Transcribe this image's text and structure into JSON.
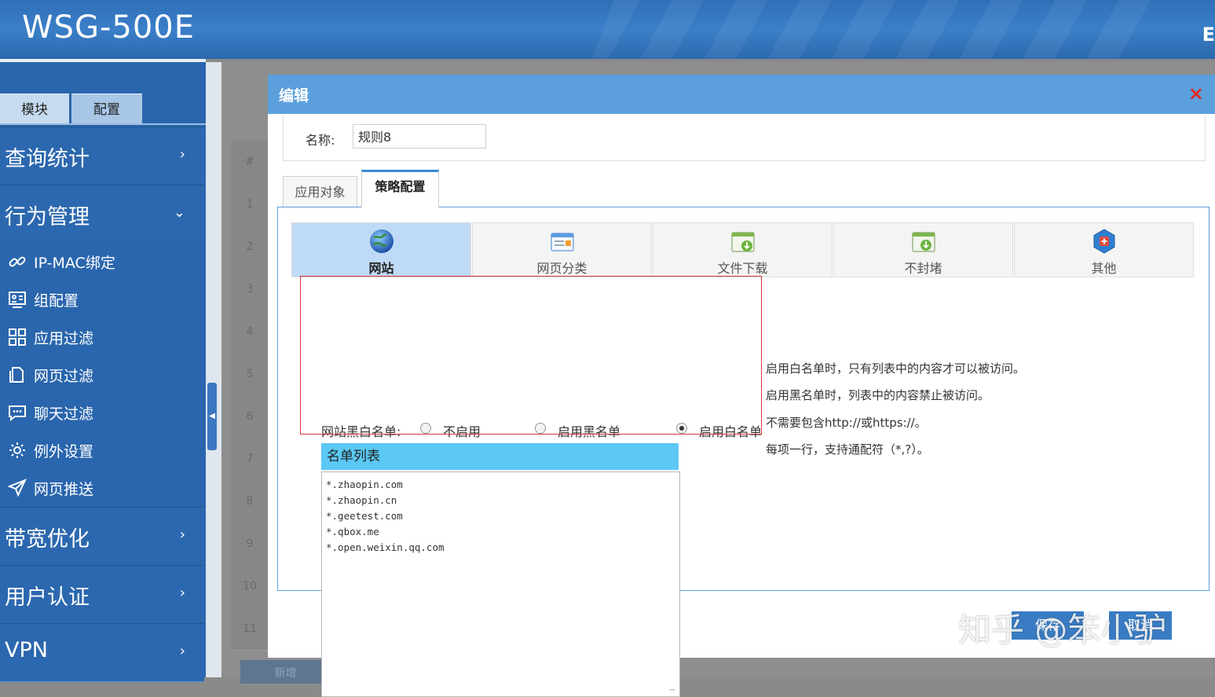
{
  "header": {
    "logo": "WSG-500E",
    "right_text": "E"
  },
  "sidebar": {
    "top_tabs": [
      "模块",
      "配置"
    ],
    "categories": [
      {
        "label": "查询统计",
        "arrow": ">"
      },
      {
        "label": "行为管理",
        "arrow": "v"
      },
      {
        "label": "带宽优化",
        "arrow": ">"
      },
      {
        "label": "用户认证",
        "arrow": ">"
      },
      {
        "label": "VPN",
        "arrow": ">"
      }
    ],
    "sub_items": [
      {
        "label": "IP-MAC绑定",
        "icon": "link-icon"
      },
      {
        "label": "组配置",
        "icon": "group-config-icon"
      },
      {
        "label": "应用过滤",
        "icon": "grid-icon"
      },
      {
        "label": "网页过滤",
        "icon": "page-filter-icon"
      },
      {
        "label": "聊天过滤",
        "icon": "chat-icon"
      },
      {
        "label": "例外设置",
        "icon": "gear-icon"
      },
      {
        "label": "网页推送",
        "icon": "send-icon"
      }
    ]
  },
  "background_table": {
    "row_numbers": [
      "#",
      "1",
      "2",
      "3",
      "4",
      "5",
      "6",
      "7",
      "8",
      "9",
      "10",
      "11"
    ],
    "button": "新增"
  },
  "modal": {
    "title": "编辑",
    "close": "×",
    "name_label": "名称:",
    "name_value": "规则8",
    "tabs": [
      "应用对象",
      "策略配置"
    ],
    "subtabs": [
      {
        "label": "网站",
        "icon": "globe-icon"
      },
      {
        "label": "网页分类",
        "icon": "web-category-icon"
      },
      {
        "label": "文件下载",
        "icon": "file-download-icon"
      },
      {
        "label": "不封堵",
        "icon": "no-block-icon"
      },
      {
        "label": "其他",
        "icon": "other-icon"
      }
    ],
    "radio_group_label": "网站黑白名单:",
    "radio_options": [
      {
        "label": "不启用",
        "checked": false
      },
      {
        "label": "启用黑名单",
        "checked": false
      },
      {
        "label": "启用白名单",
        "checked": true
      }
    ],
    "list_header": "名单列表",
    "list_items": [
      "*.zhaopin.com",
      "*.zhaopin.cn",
      "*.geetest.com",
      "*.qbox.me",
      "*.open.weixin.qq.com"
    ],
    "hints": [
      "启用白名单时，只有列表中的内容才可以被访问。",
      "启用黑名单时，列表中的内容禁止被访问。",
      "不需要包含http://或https://。",
      "每项一行，支持通配符（*,?）。"
    ],
    "save_button": "保存",
    "cancel_button": "取消"
  },
  "watermark": "知乎 @笨小驴",
  "colors": {
    "accent": "#5b9fdd",
    "sidebar": "#2a66ad",
    "highlight_frame": "#d9363a"
  }
}
